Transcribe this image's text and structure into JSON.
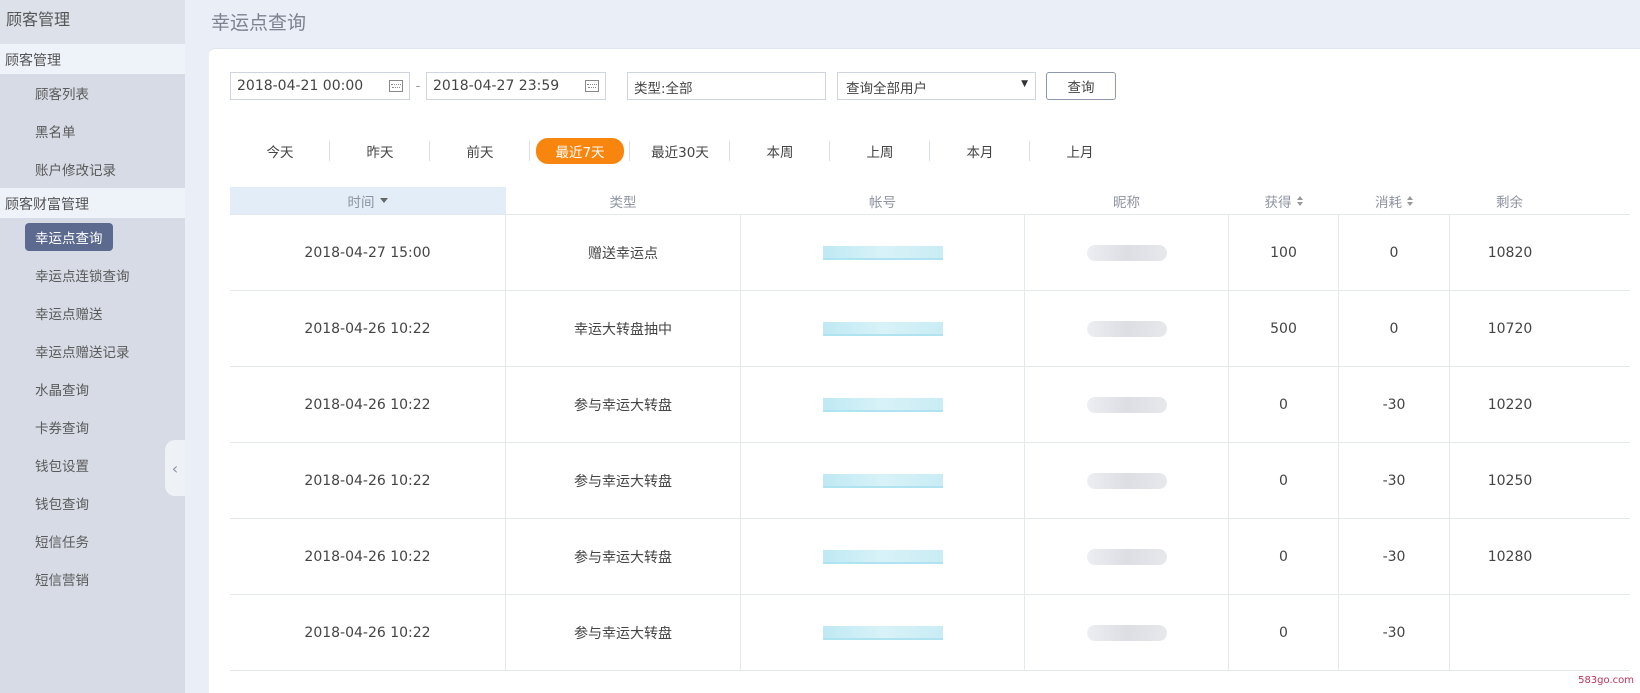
{
  "sidebar": {
    "top_title": "顾客管理",
    "section1": "顾客管理",
    "section1_items": [
      "顾客列表",
      "黑名单",
      "账户修改记录"
    ],
    "section2": "顾客财富管理",
    "section2_items": [
      "幸运点查询",
      "幸运点连锁查询",
      "幸运点赠送",
      "幸运点赠送记录",
      "水晶查询",
      "卡券查询",
      "钱包设置",
      "钱包查询",
      "短信任务",
      "短信营销"
    ],
    "active_item": "幸运点查询",
    "collapse_glyph": "‹"
  },
  "page": {
    "title": "幸运点查询"
  },
  "filters": {
    "start_date": "2018-04-21 00:00",
    "end_date": "2018-04-27 23:59",
    "dash": "-",
    "type_value": "类型:全部",
    "user_select": "查询全部用户",
    "query_label": "查询"
  },
  "ranges": [
    "今天",
    "昨天",
    "前天",
    "最近7天",
    "最近30天",
    "本周",
    "上周",
    "本月",
    "上月"
  ],
  "active_range": "最近7天",
  "table": {
    "headers": [
      "时间",
      "类型",
      "帐号",
      "昵称",
      "获得",
      "消耗",
      "剩余"
    ],
    "rows": [
      {
        "time": "2018-04-27 15:00",
        "type": "赠送幸运点",
        "gain": "100",
        "cost": "0",
        "left": "10820"
      },
      {
        "time": "2018-04-26 10:22",
        "type": "幸运大转盘抽中",
        "gain": "500",
        "cost": "0",
        "left": "10720"
      },
      {
        "time": "2018-04-26 10:22",
        "type": "参与幸运大转盘",
        "gain": "0",
        "cost": "-30",
        "left": "10220"
      },
      {
        "time": "2018-04-26 10:22",
        "type": "参与幸运大转盘",
        "gain": "0",
        "cost": "-30",
        "left": "10250"
      },
      {
        "time": "2018-04-26 10:22",
        "type": "参与幸运大转盘",
        "gain": "0",
        "cost": "-30",
        "left": "10280"
      },
      {
        "time": "2018-04-26 10:22",
        "type": "参与幸运大转盘",
        "gain": "0",
        "cost": "-30",
        "left": ""
      }
    ]
  },
  "watermark": "583go.com",
  "colors": {
    "accent": "#f7850e",
    "active_nav": "#5d6a8f",
    "sidebar_bg": "#d6dbe5"
  }
}
